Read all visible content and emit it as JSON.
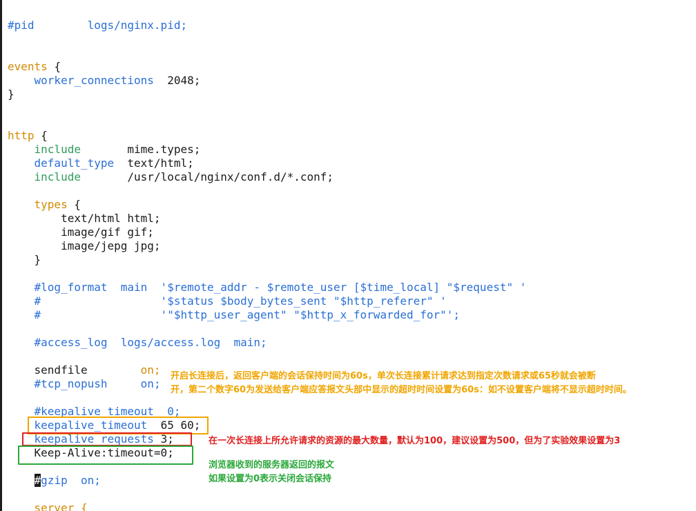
{
  "code": {
    "pid_comment": "#pid",
    "pid_value": "logs/nginx.pid;",
    "events_kw": "events",
    "open_brace": "{",
    "close_brace": "}",
    "worker_connections_kw": "worker_connections",
    "worker_connections_val": "2048;",
    "http_kw": "http",
    "include1_kw": "include",
    "include1_val": "mime.types;",
    "default_type_kw": "default_type",
    "default_type_val": "text/html;",
    "include2_kw": "include",
    "include2_val": "/usr/local/nginx/conf.d/*.conf;",
    "types_kw": "types",
    "types_1": "text/html html;",
    "types_2": "image/gif gif;",
    "types_3": "image/jepg jpg;",
    "log_format_1": "#log_format  main  '$remote_addr - $remote_user [$time_local] \"$request\" '",
    "log_format_2": "#                  '$status $body_bytes_sent \"$http_referer\" '",
    "log_format_3": "#                  '\"$http_user_agent\" \"$http_x_forwarded_for\"';",
    "access_log": "#access_log  logs/access.log  main;",
    "sendfile_kw": "sendfile",
    "sendfile_val": "on;",
    "tcp_nopush_kw": "#tcp_nopush",
    "tcp_nopush_val": "on;",
    "keepalive_timeout_comment": "#keepalive_timeout  0;",
    "keepalive_timeout_kw": "keepalive_timeout",
    "keepalive_timeout_val": "65 60;",
    "keepalive_requests_kw": "keepalive_requests",
    "keepalive_requests_val": "3;",
    "keep_alive_header": "Keep-Alive:timeout=0;",
    "gzip_cursor": "#",
    "gzip_rest": "gzip  on;",
    "server_kw": "server {"
  },
  "annotations": {
    "orange_line1": "开启长连接后，返回客户端的会话保持时间为60s，单次长连接累计请求达到指定次数请求或65秒就会被断",
    "orange_line2": "开，第二个数字60为发送给客户端应答报文头部中显示的超时时间设置为60s：如不设置客户端将不显示超时时间。",
    "red_note": "在一次长连接上所允许请求的资源的最大数量，默认为100，建议设置为500，但为了实验效果设置为3",
    "green_line1": "浏览器收到的服务器返回的报文",
    "green_line2": "如果设置为0表示关闭会话保持"
  },
  "colors": {
    "orange": "#f0a500",
    "red": "#e02020",
    "green": "#2aa83a",
    "keyword_blue": "#2a6fd6",
    "keyword_green": "#2e9a5a"
  }
}
